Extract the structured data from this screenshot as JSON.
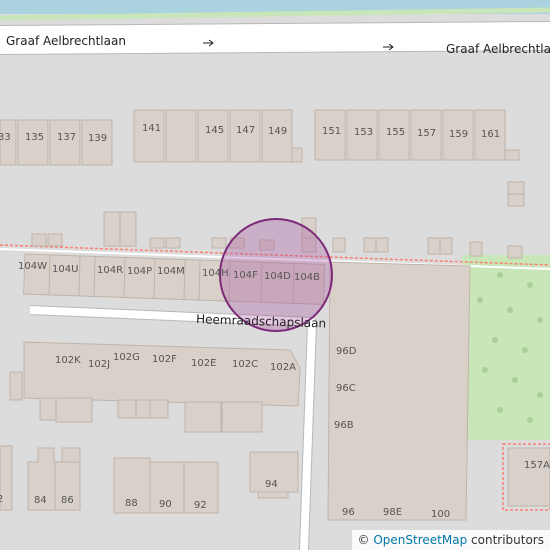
{
  "map": {
    "streets": {
      "north_left": "Graaf Aelbrechtlaan",
      "north_right": "Graaf Aelbrechtlaan",
      "side": "Heemraadschapslaan"
    },
    "north_row_numbers": [
      "33",
      "135",
      "137",
      "139",
      "141",
      "145",
      "147",
      "149",
      "151",
      "153",
      "155",
      "157",
      "159",
      "161"
    ],
    "row_104": [
      "104W",
      "104U",
      "104R",
      "104P",
      "104M",
      "104H",
      "104F",
      "104D",
      "104B"
    ],
    "row_102": [
      "102K",
      "102J",
      "102G",
      "102F",
      "102E",
      "102C",
      "102A"
    ],
    "bottom_row": [
      "84",
      "86",
      "88",
      "90",
      "92",
      "94"
    ],
    "right_block": [
      "96D",
      "96C",
      "96B",
      "96",
      "98E",
      "100"
    ],
    "far_right": "157A",
    "edge_left_label": "2",
    "attribution": {
      "symbol": "©",
      "link_text": "OpenStreetMap",
      "suffix": " contributors"
    }
  }
}
